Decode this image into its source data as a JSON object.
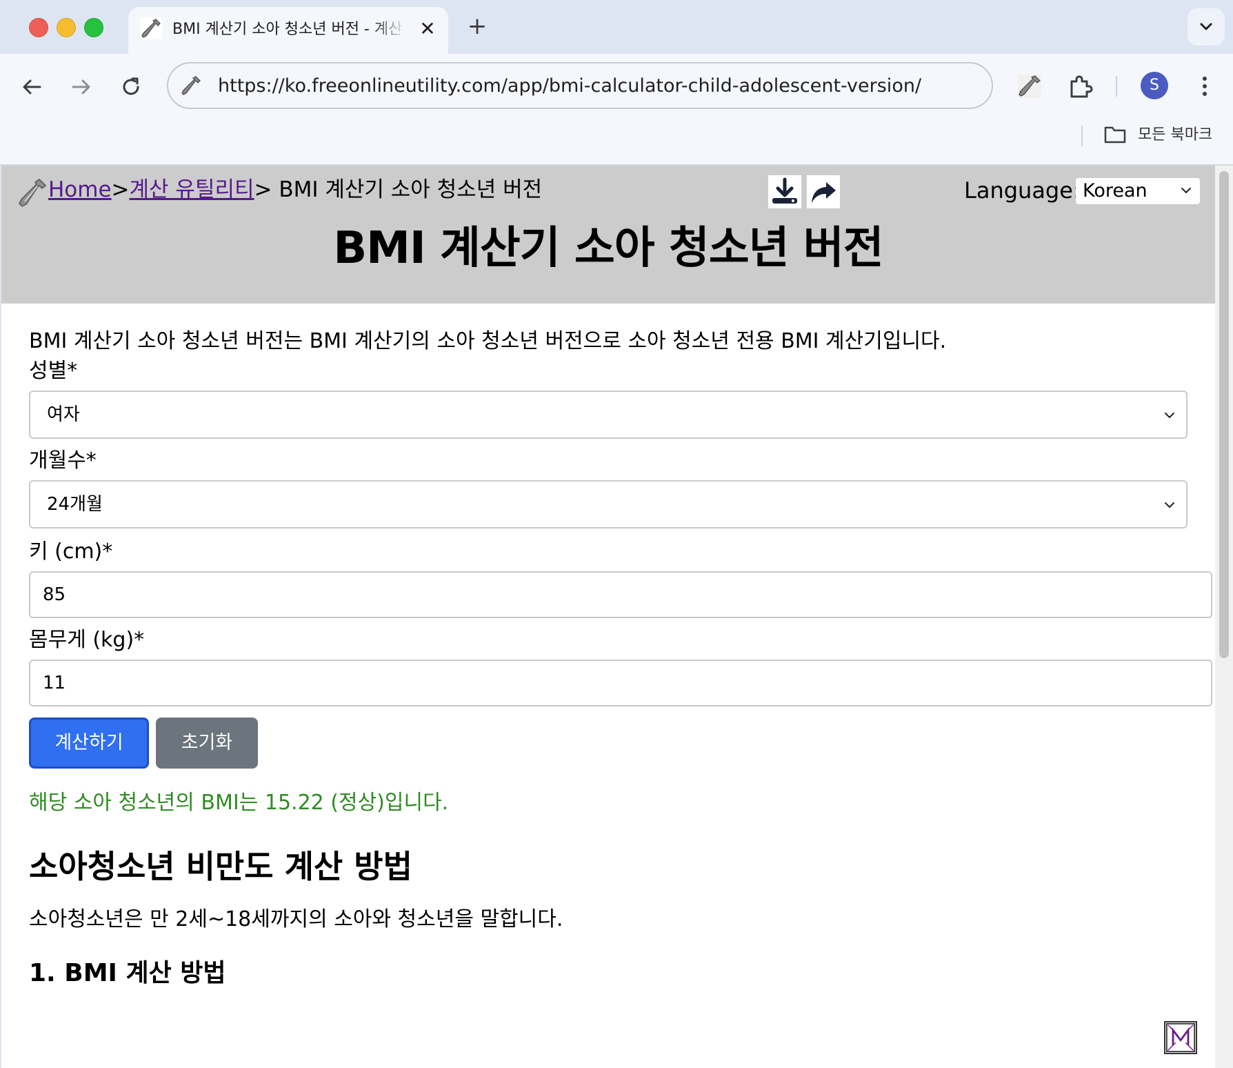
{
  "browser": {
    "tab_title": "BMI 계산기 소아 청소년 버전 - 계산 유틸리티",
    "tab_close": "✕",
    "new_tab": "+",
    "url": "https://ko.freeonlineutility.com/app/bmi-calculator-child-adolescent-version/",
    "profile_initial": "S",
    "bookmarks_label": "모든 북마크"
  },
  "header": {
    "breadcrumb": {
      "home": "Home",
      "separator": ">",
      "category": "계산 유틸리티",
      "current": "> BMI 계산기 소아 청소년 버전"
    },
    "language_label": "Language:",
    "language_value": "Korean",
    "title": "BMI 계산기 소아 청소년 버전"
  },
  "form": {
    "intro": "BMI 계산기 소아 청소년 버전는 BMI 계산기의 소아 청소년 버전으로 소아 청소년 전용 BMI 계산기입니다.",
    "gender_label": "성별*",
    "gender_value": "여자",
    "months_label": "개월수*",
    "months_value": "24개월",
    "height_label": "키 (cm)*",
    "height_value": "85",
    "weight_label": "몸무게 (kg)*",
    "weight_value": "11",
    "calculate_button": "계산하기",
    "reset_button": "초기화"
  },
  "result": {
    "text": "해당 소아 청소년의 BMI는 15.22 (정상)입니다."
  },
  "article": {
    "heading": "소아청소년 비만도 계산 방법",
    "paragraph": "소아청소년은 만 2세~18세까지의 소아와 청소년을 말합니다.",
    "subheading": "1. BMI 계산 방법"
  },
  "colors": {
    "calculate_button": "#2f6ff0",
    "reset_button": "#6c757d",
    "result_text": "#2e8b22",
    "header_bg": "#cccccc"
  }
}
